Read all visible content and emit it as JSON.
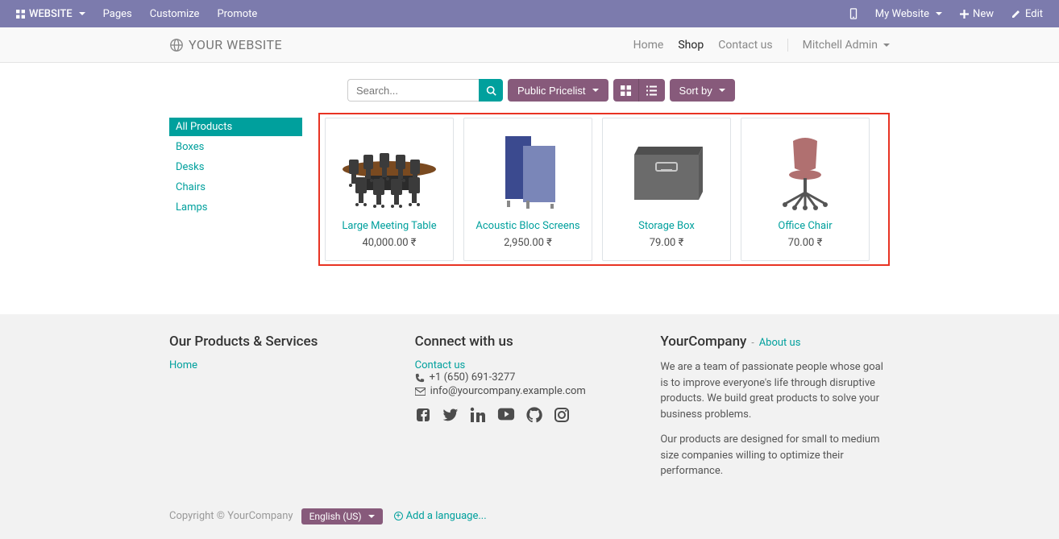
{
  "topbar": {
    "website": "WEBSITE",
    "pages": "Pages",
    "customize": "Customize",
    "promote": "Promote",
    "my_website": "My Website",
    "new_btn": "New",
    "edit_btn": "Edit"
  },
  "header": {
    "logo_text": "YOUR WEBSITE",
    "nav": {
      "home": "Home",
      "shop": "Shop",
      "contact": "Contact us"
    },
    "user": "Mitchell Admin"
  },
  "sidebar": {
    "items": [
      "All Products",
      "Boxes",
      "Desks",
      "Chairs",
      "Lamps"
    ]
  },
  "filters": {
    "search_placeholder": "Search...",
    "pricelist": "Public Pricelist",
    "sort_by": "Sort by"
  },
  "products": [
    {
      "name": "Large Meeting Table",
      "price": "40,000.00 ₹"
    },
    {
      "name": "Acoustic Bloc Screens",
      "price": "2,950.00 ₹"
    },
    {
      "name": "Storage Box",
      "price": "79.00 ₹"
    },
    {
      "name": "Office Chair",
      "price": "70.00 ₹"
    }
  ],
  "footer": {
    "col1_title": "Our Products & Services",
    "col1_link": "Home",
    "col2_title": "Connect with us",
    "contact_link": "Contact us",
    "phone": "+1 (650) 691-3277",
    "email": "info@yourcompany.example.com",
    "brand": "YourCompany",
    "about_us": "About us",
    "about_dash": " - ",
    "about_p1": "We are a team of passionate people whose goal is to improve everyone's life through disruptive products. We build great products to solve your business problems.",
    "about_p2": "Our products are designed for small to medium size companies willing to optimize their performance."
  },
  "copyright": {
    "text": "Copyright © YourCompany",
    "lang": "English (US)",
    "add_lang": "Add a language..."
  }
}
